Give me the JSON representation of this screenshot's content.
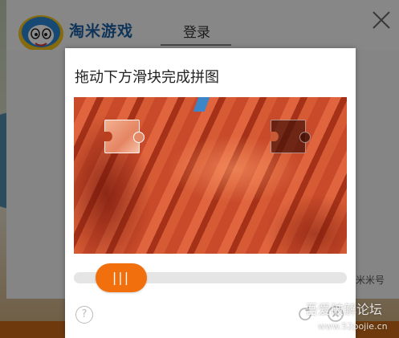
{
  "background": {
    "brand_name": "淘米游戏",
    "login_tab": "登录",
    "side_hint": "米米号"
  },
  "captcha": {
    "title": "拖动下方滑块完成拼图",
    "slider_grip": "|||",
    "help_label": "?"
  },
  "watermark": {
    "text": "吾爱破解论坛",
    "url": "www.52pojie.cn"
  },
  "colors": {
    "accent": "#f26f0e",
    "track": "#e5e5e5"
  }
}
